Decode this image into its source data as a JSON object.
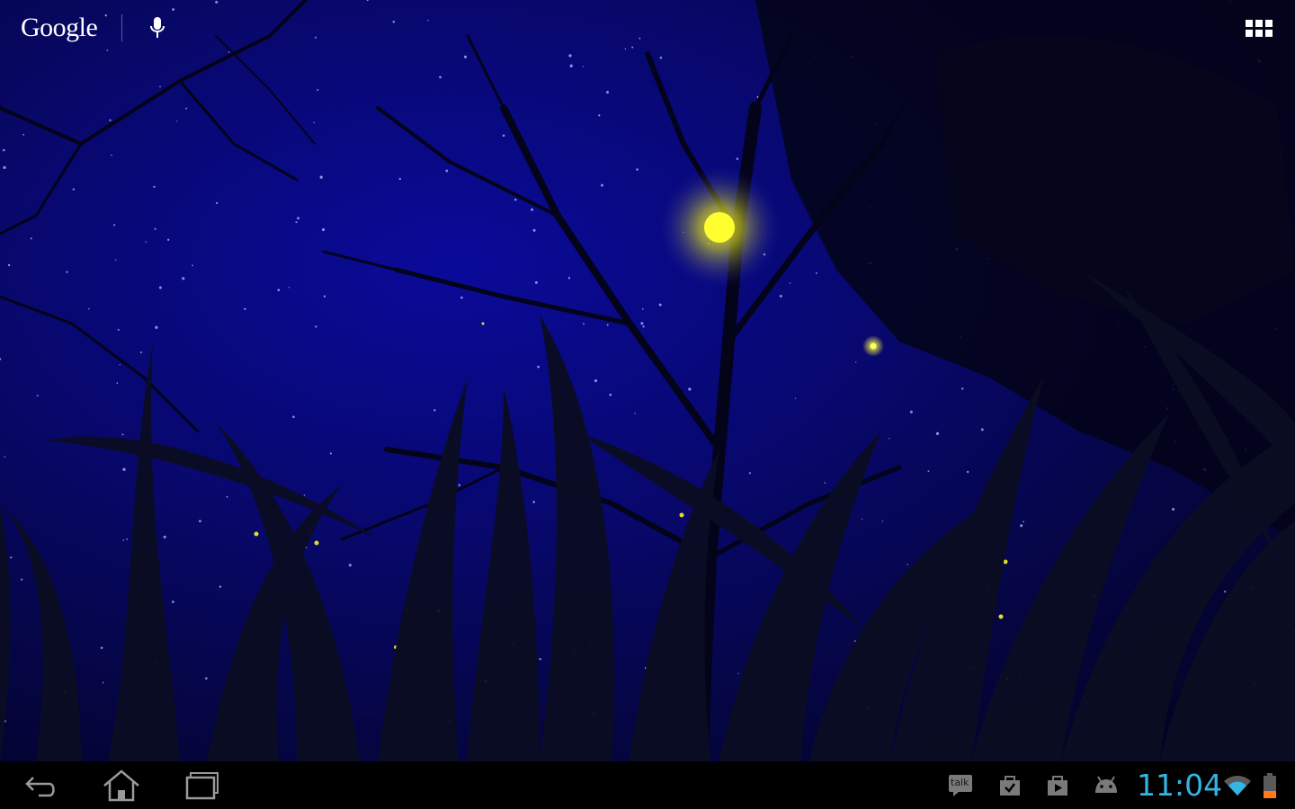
{
  "search_widget": {
    "logo_text": "Google",
    "mic_icon": "microphone-icon"
  },
  "launcher": {
    "apps_icon": "app-grid-icon"
  },
  "wallpaper": {
    "theme": "night sky fireflies live wallpaper",
    "sky_color": "#0a0a9a",
    "firefly_color": "#ffff20"
  },
  "system_bar": {
    "nav": [
      {
        "icon": "back-icon"
      },
      {
        "icon": "home-icon"
      },
      {
        "icon": "recent-apps-icon"
      }
    ],
    "notifications": [
      {
        "icon": "talk-icon",
        "text": "talk"
      },
      {
        "icon": "task-bag-icon"
      },
      {
        "icon": "play-store-icon"
      },
      {
        "icon": "android-debug-icon"
      }
    ],
    "time": "11:04",
    "status_icons": [
      "wifi-icon",
      "battery-icon"
    ],
    "accent_color": "#33b5e5"
  }
}
